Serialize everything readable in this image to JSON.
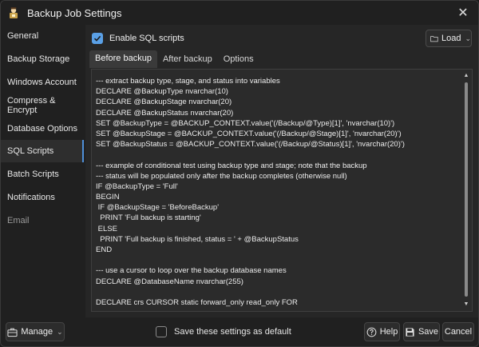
{
  "window": {
    "title": "Backup Job Settings",
    "close_symbol": "✕"
  },
  "sidebar": {
    "items": [
      {
        "label": "General"
      },
      {
        "label": "Backup Storage"
      },
      {
        "label": "Windows Account"
      },
      {
        "label": "Compress & Encrypt"
      },
      {
        "label": "Database Options"
      },
      {
        "label": "SQL Scripts",
        "active": true
      },
      {
        "label": "Batch Scripts"
      },
      {
        "label": "Notifications"
      },
      {
        "label": "Email",
        "dimmed": true
      }
    ]
  },
  "content": {
    "enable_sql_scripts": {
      "label": "Enable SQL scripts",
      "checked": true
    },
    "load_button": {
      "label": "Load"
    },
    "tabs": [
      {
        "label": "Before backup",
        "active": true
      },
      {
        "label": "After backup"
      },
      {
        "label": "Options"
      }
    ],
    "script_lines": [
      "--- extract backup type, stage, and status into variables",
      "DECLARE @BackupType nvarchar(10)",
      "DECLARE @BackupStage nvarchar(20)",
      "DECLARE @BackupStatus nvarchar(20)",
      "SET @BackupType = @BACKUP_CONTEXT.value('(/Backup/@Type)[1]', 'nvarchar(10)')",
      "SET @BackupStage = @BACKUP_CONTEXT.value('(/Backup/@Stage)[1]', 'nvarchar(20)')",
      "SET @BackupStatus = @BACKUP_CONTEXT.value('(/Backup/@Status)[1]', 'nvarchar(20)')",
      "",
      "--- example of conditional test using backup type and stage; note that the backup",
      "--- status will be populated only after the backup completes (otherwise null)",
      "IF @BackupType = 'Full'",
      "BEGIN",
      " IF @BackupStage = 'BeforeBackup'",
      "  PRINT 'Full backup is starting'",
      " ELSE",
      "  PRINT 'Full backup is finished, status = ' + @BackupStatus",
      "END",
      "",
      "--- use a cursor to loop over the backup database names",
      "DECLARE @DatabaseName nvarchar(255)",
      "",
      "DECLARE crs CURSOR static forward_only read_only FOR"
    ]
  },
  "footer": {
    "manage_button": {
      "label": "Manage"
    },
    "save_default": {
      "label": "Save these settings as default",
      "checked": false
    },
    "help_button": {
      "label": "Help"
    },
    "save_button": {
      "label": "Save"
    },
    "cancel_button": {
      "label": "Cancel"
    }
  },
  "colors": {
    "accent": "#5aa0e6",
    "window_bg": "#202020",
    "panel_bg": "#262626",
    "editor_bg": "#2b2b2b"
  },
  "icons": {
    "app": "app-logo-icon",
    "close": "close-icon",
    "load": "folder-icon",
    "manage": "briefcase-icon",
    "help": "help-circle-icon",
    "save": "floppy-disk-icon"
  }
}
